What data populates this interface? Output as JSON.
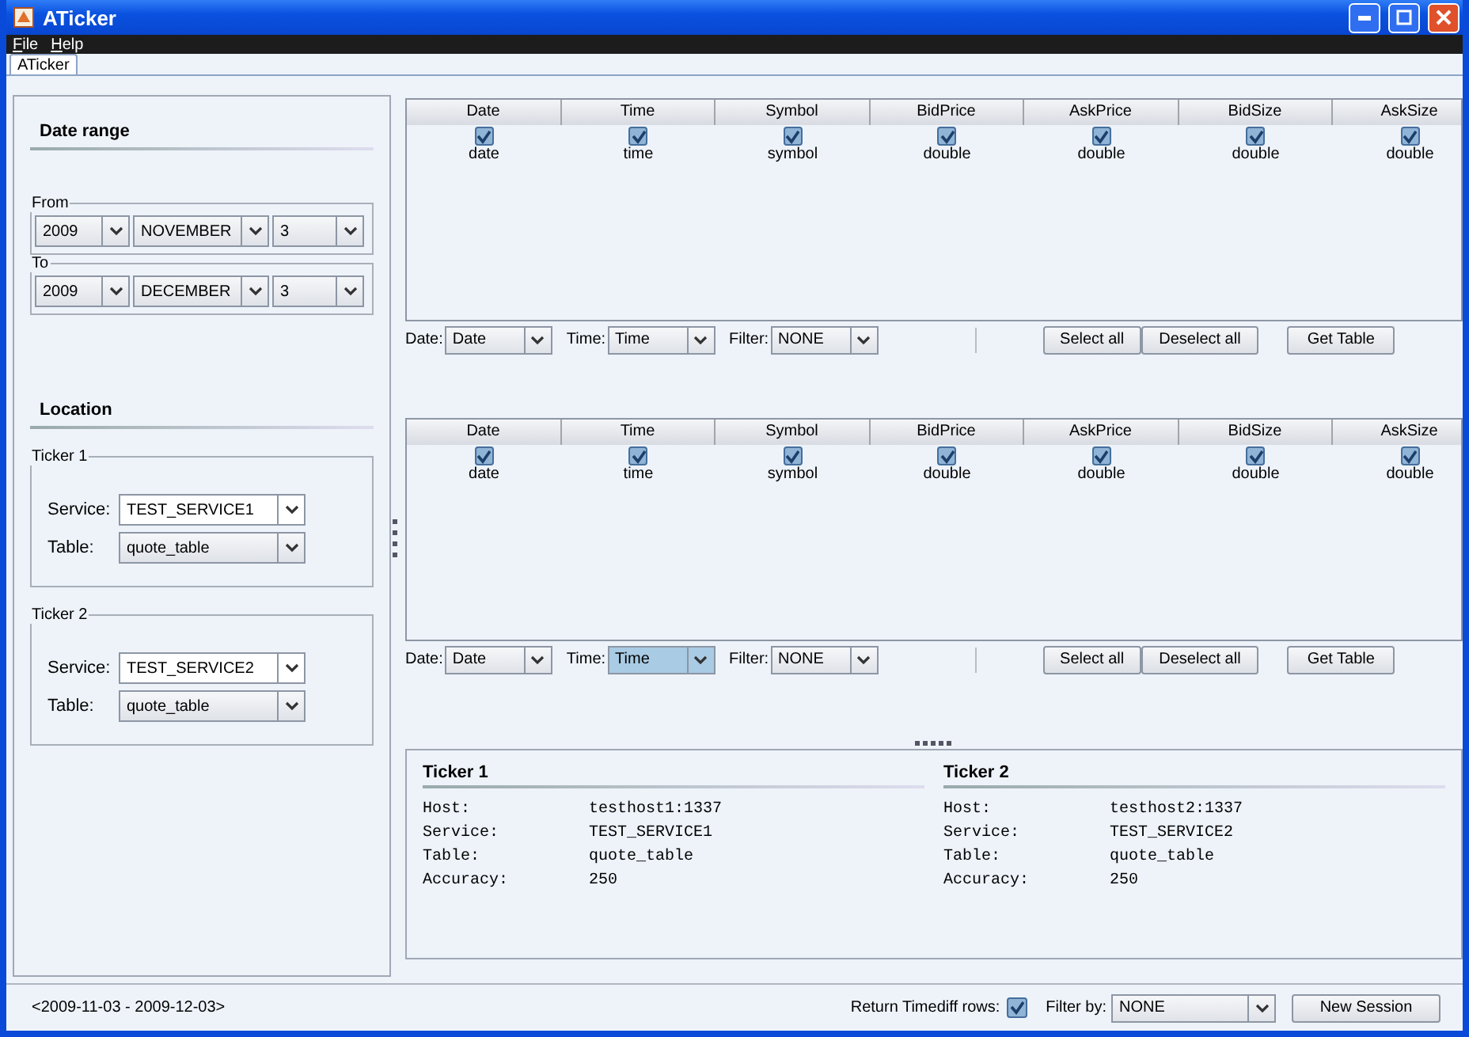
{
  "window": {
    "title": "ATicker"
  },
  "menu": [
    {
      "label": "File"
    },
    {
      "label": "Help"
    }
  ],
  "tabs": [
    {
      "label": "ATicker",
      "selected": true
    }
  ],
  "date_range": {
    "title": "Date range",
    "ranges": [
      {
        "legend": "From",
        "year": "2009",
        "month": "NOVEMBER",
        "day": "3"
      },
      {
        "legend": "To",
        "year": "2009",
        "month": "DECEMBER",
        "day": "3"
      }
    ]
  },
  "location": {
    "title": "Location",
    "tickers": [
      {
        "legend": "Ticker 1",
        "service_label": "Service:",
        "service": "TEST_SERVICE1",
        "table_label": "Table:",
        "table": "quote_table"
      },
      {
        "legend": "Ticker 2",
        "service_label": "Service:",
        "service": "TEST_SERVICE2",
        "table_label": "Table:",
        "table": "quote_table"
      }
    ]
  },
  "queries": [
    {
      "columns": [
        {
          "header": "Date",
          "checked": true,
          "type": "date"
        },
        {
          "header": "Time",
          "checked": true,
          "type": "time"
        },
        {
          "header": "Symbol",
          "checked": true,
          "type": "symbol"
        },
        {
          "header": "BidPrice",
          "checked": true,
          "type": "double"
        },
        {
          "header": "AskPrice",
          "checked": true,
          "type": "double"
        },
        {
          "header": "BidSize",
          "checked": true,
          "type": "double"
        },
        {
          "header": "AskSize",
          "checked": true,
          "type": "double"
        }
      ],
      "selectors": [
        {
          "label": "Date:",
          "value": "Date",
          "focused": false
        },
        {
          "label": "Time:",
          "value": "Time",
          "focused": false
        },
        {
          "label": "Filter:",
          "value": "NONE",
          "focused": false
        }
      ],
      "buttons": [
        "Select all",
        "Deselect all",
        "Get Table"
      ]
    },
    {
      "columns": [
        {
          "header": "Date",
          "checked": true,
          "type": "date"
        },
        {
          "header": "Time",
          "checked": true,
          "type": "time"
        },
        {
          "header": "Symbol",
          "checked": true,
          "type": "symbol"
        },
        {
          "header": "BidPrice",
          "checked": true,
          "type": "double"
        },
        {
          "header": "AskPrice",
          "checked": true,
          "type": "double"
        },
        {
          "header": "BidSize",
          "checked": true,
          "type": "double"
        },
        {
          "header": "AskSize",
          "checked": true,
          "type": "double"
        }
      ],
      "selectors": [
        {
          "label": "Date:",
          "value": "Date",
          "focused": false
        },
        {
          "label": "Time:",
          "value": "Time",
          "focused": true
        },
        {
          "label": "Filter:",
          "value": "NONE",
          "focused": false
        }
      ],
      "buttons": [
        "Select all",
        "Deselect all",
        "Get Table"
      ]
    }
  ],
  "info": [
    {
      "title": "Ticker 1",
      "rows": [
        {
          "label": "Host:",
          "value": "testhost1:1337"
        },
        {
          "label": "Service:",
          "value": "TEST_SERVICE1"
        },
        {
          "label": "Table:",
          "value": "quote_table"
        },
        {
          "label": "Accuracy:",
          "value": "250"
        }
      ]
    },
    {
      "title": "Ticker 2",
      "rows": [
        {
          "label": "Host:",
          "value": "testhost2:1337"
        },
        {
          "label": "Service:",
          "value": "TEST_SERVICE2"
        },
        {
          "label": "Table:",
          "value": "quote_table"
        },
        {
          "label": "Accuracy:",
          "value": "250"
        }
      ]
    }
  ],
  "status_bar": {
    "range": "<2009-11-03  -  2009-12-03>",
    "timediff_label": "Return Timediff rows:",
    "timediff_checked": true,
    "filter_label": "Filter by:",
    "filter_value": "NONE",
    "button": "New Session"
  }
}
